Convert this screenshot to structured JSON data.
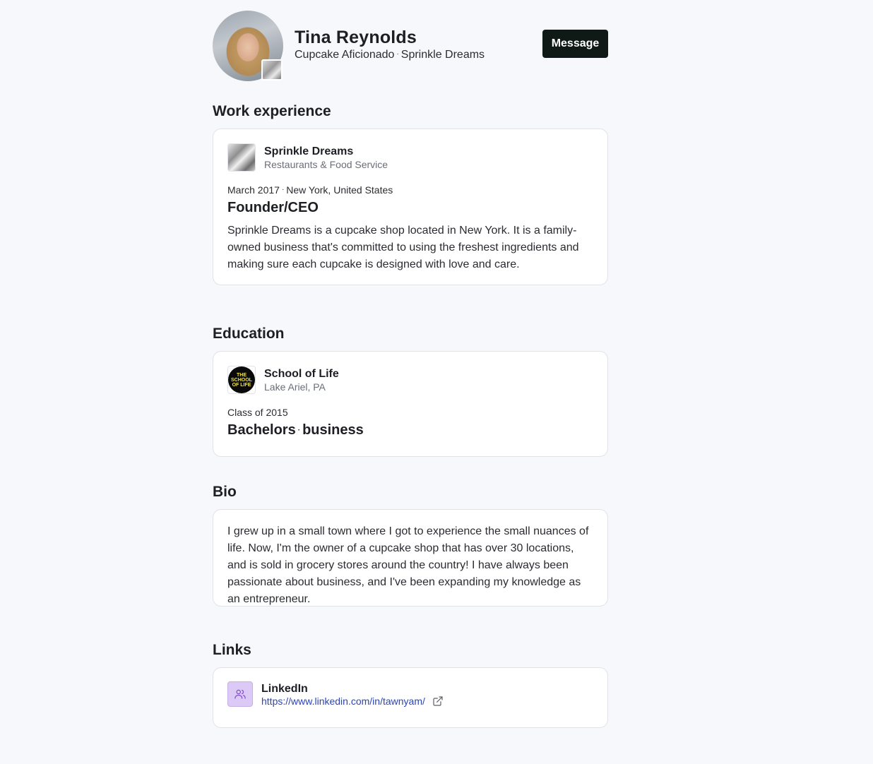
{
  "profile": {
    "name": "Tina Reynolds",
    "title": "Cupcake Aficionado",
    "company": "Sprinkle Dreams",
    "separator": "·",
    "message_label": "Message"
  },
  "work": {
    "heading": "Work experience",
    "org_name": "Sprinkle Dreams",
    "org_industry": "Restaurants & Food Service",
    "start": "March 2017",
    "location": "New York, United States",
    "role": "Founder/CEO",
    "description": "Sprinkle Dreams is a cupcake shop located in New York. It is a family-owned business that's committed to using the freshest ingredients and making sure each cupcake is designed with love and care."
  },
  "education": {
    "heading": "Education",
    "school": "School of Life",
    "location": "Lake Ariel, PA",
    "class_of": "Class of 2015",
    "degree": "Bachelors",
    "field": "business"
  },
  "bio": {
    "heading": "Bio",
    "text": "I grew up in a small town where I got to experience the small nuances of life. Now, I'm the owner of a cupcake shop that has over 30 locations, and is sold in grocery stores around the country! I have always been passionate about business, and I've been expanding my knowledge as an entrepreneur."
  },
  "links": {
    "heading": "Links",
    "items": [
      {
        "name": "LinkedIn",
        "url": "https://www.linkedin.com/in/tawnyam/",
        "icon": "people-icon"
      }
    ]
  },
  "colors": {
    "background": "#f7f8fc",
    "button": "#0f1a17",
    "link": "#2b45b8",
    "link_icon_bg": "#dcc9f5"
  }
}
